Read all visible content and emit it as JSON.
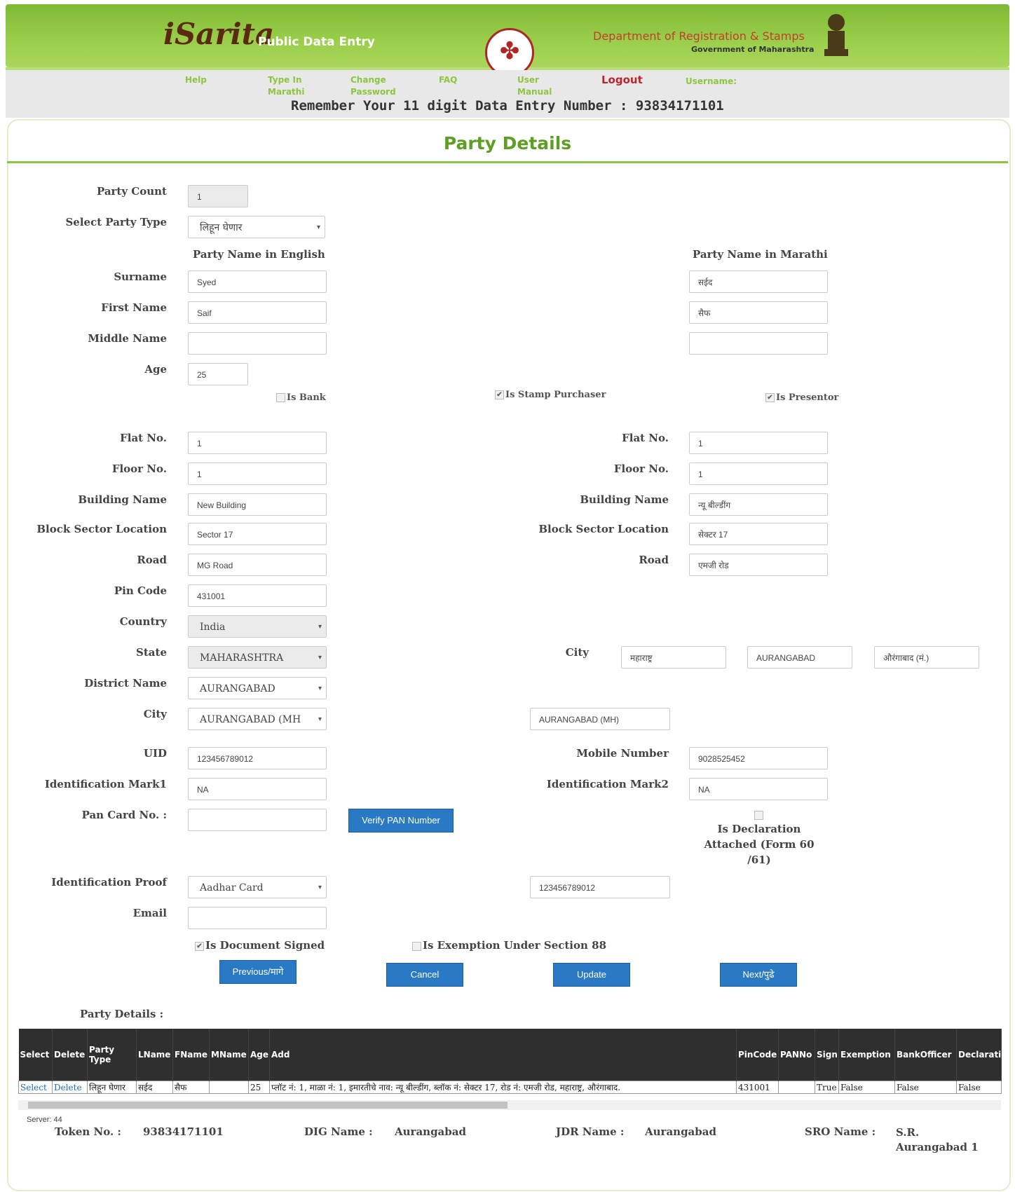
{
  "header": {
    "logo": "iSarita",
    "app_name": "Public Data Entry",
    "department": "Department of Registration & Stamps",
    "government": "Government of Maharashtra"
  },
  "nav": {
    "help": "Help",
    "type_in_marathi": [
      "Type In",
      "Marathi"
    ],
    "change_password": [
      "Change",
      "Password"
    ],
    "faq": "FAQ",
    "user_manual": [
      "User",
      "Manual"
    ],
    "logout": "Logout",
    "username_label": "Username:"
  },
  "data_entry_notice": "Remember Your 11 digit Data Entry Number :  93834171101",
  "page_title": "Party Details",
  "form": {
    "party_count_label": "Party Count",
    "party_count": "1",
    "party_type_label": "Select Party Type",
    "party_type": "लिहून घेणार",
    "english_header": "Party Name in English",
    "marathi_header": "Party Name in Marathi",
    "surname_label": "Surname",
    "surname_en": "Syed",
    "surname_mr": "सईद",
    "first_name_label": "First Name",
    "first_name_en": "Saif",
    "first_name_mr": "सैफ",
    "middle_name_label": "Middle Name",
    "middle_name_en": "",
    "middle_name_mr": "",
    "age_label": "Age",
    "age": "25",
    "is_bank": "Is Bank",
    "is_stamp_purchaser": "Is Stamp Purchaser",
    "is_presentor": "Is Presentor",
    "flat_label": "Flat No.",
    "flat_en": "1",
    "flat_mr": "1",
    "floor_label": "Floor No.",
    "floor_en": "1",
    "floor_mr": "1",
    "building_label": "Building Name",
    "building_en": "New Building",
    "building_mr": "न्यू बील्डींग",
    "block_label": "Block Sector Location",
    "block_en": "Sector 17",
    "block_mr": "सेक्टर 17",
    "road_label": "Road",
    "road_en": "MG Road",
    "road_mr": "एमजी रोड",
    "pin_label": "Pin Code",
    "pin": "431001",
    "country_label": "Country",
    "country": "India",
    "state_label": "State",
    "state": "MAHARASHTRA",
    "city_label_right": "City",
    "city_state_mr": "महाराष्ट्र",
    "city_district": "AURANGABAD",
    "city_mr": "औरंगाबाद (मं.)",
    "district_label": "District Name",
    "district": "AURANGABAD",
    "city_label": "City",
    "city": "AURANGABAD (MH",
    "city_text": "AURANGABAD (MH)",
    "uid_label": "UID",
    "uid": "123456789012",
    "mobile_label": "Mobile Number",
    "mobile": "9028525452",
    "idmark1_label": "Identification Mark1",
    "idmark1": "NA",
    "idmark2_label": "Identification Mark2",
    "idmark2": "NA",
    "pan_label": "Pan Card No. :",
    "pan": "",
    "verify_pan": "Verify PAN Number",
    "declaration": [
      "Is Declaration",
      "Attached (Form 60",
      "/61)"
    ],
    "id_proof_label": "Identification Proof",
    "id_proof": "Aadhar Card",
    "id_proof_no": "123456789012",
    "email_label": "Email",
    "email": "",
    "is_doc_signed": "Is Document Signed",
    "is_exemption": "Is Exemption Under Section 88"
  },
  "buttons": {
    "previous": "Previous/मागे",
    "cancel": "Cancel",
    "update": "Update",
    "next": "Next/पुढे"
  },
  "grid": {
    "title": "Party Details :",
    "columns": [
      "Select",
      "Delete",
      "Party Type",
      "LName",
      "FName",
      "MName",
      "Age",
      "Add",
      "PinCode",
      "PANNo",
      "Sign",
      "Exemption",
      "BankOfficer",
      "Declaration"
    ],
    "rows": [
      [
        "Select",
        "Delete",
        "लिहून घेणार",
        "सईद",
        "सैफ",
        "",
        "25",
        "प्लॉट नं: 1, माळा नं: 1, इमारतीचे नाव: न्यू बील्डींग, ब्लॉक नं: सेक्टर 17, रोड नं: एमजी रोड, महाराष्ट्र, औरंगाबाद.",
        "431001",
        "",
        "True",
        "False",
        "False",
        "False"
      ]
    ]
  },
  "footer": {
    "server": "Server: 44",
    "token_label": "Token No. :",
    "token": "93834171101",
    "dig_label": "DIG Name :",
    "dig": "Aurangabad",
    "jdr_label": "JDR Name :",
    "jdr": "Aurangabad",
    "sro_label": "SRO Name :",
    "sro": [
      "S.R.",
      "Aurangabad 1"
    ]
  }
}
